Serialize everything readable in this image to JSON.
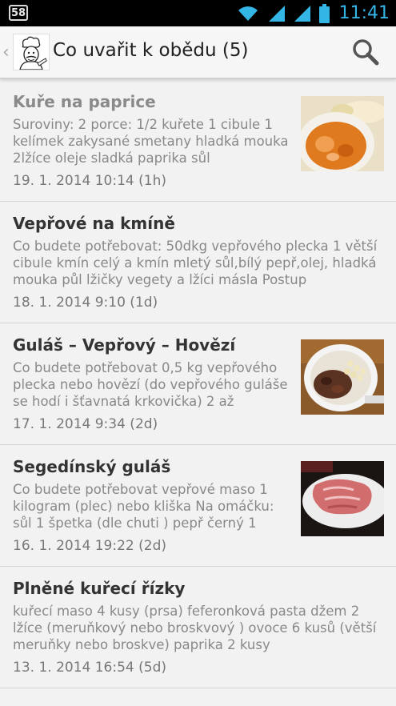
{
  "status_bar": {
    "badge": "58",
    "time": "11:41",
    "icons": [
      "wifi-icon",
      "signal-icon",
      "signal-icon",
      "battery-icon"
    ]
  },
  "action_bar": {
    "title": "Co uvařit k obědu (5)",
    "icons": [
      "back-caret-icon",
      "chef-app-icon",
      "search-icon"
    ]
  },
  "recipes": [
    {
      "title": "Kuře na paprice",
      "description": "Suroviny: 2 porce: 1/2 kuřete 1 cibule 1 kelímek zakysané smetany hladká mouka 2lžíce oleje sladká paprika sůl",
      "date": "19. 1. 2014 10:14 (1h)",
      "has_image": true,
      "read": true
    },
    {
      "title": "Vepřové na kmíně",
      "description": "Co budete potřebovat: 50dkg vepřového plecka 1 větší cibule kmín celý a kmín mletý sůl,bílý pepř,olej, hladká mouka půl lžičky vegety a lžíci másla Postup",
      "date": "18. 1. 2014 9:10 (1d)",
      "has_image": false,
      "read": false
    },
    {
      "title": "Guláš – Vepřový – Hovězí",
      "description": "Co budete potřebovat 0,5 kg vepřového plecka nebo hovězí (do vepřového guláše se hodí i šťavnatá krkovička) 2 až",
      "date": "17. 1. 2014 9:34 (2d)",
      "has_image": true,
      "read": false
    },
    {
      "title": "Segedínský guláš",
      "description": "Co budete potřebovat vepřové maso 1 kilogram (plec) nebo kliška Na omáčku: sůl 1 špetka (dle chuti ) pepř černý 1",
      "date": "16. 1. 2014 19:22 (2d)",
      "has_image": true,
      "read": false
    },
    {
      "title": "Plněné kuřecí řízky",
      "description": "kuřecí maso 4 kusy (prsa) feferonková pasta džem 2 lžíce (meruňkový nebo broskvový ) ovoce 6 kusů (větší meruňky nebo broskve) paprika 2 kusy",
      "date": "13. 1. 2014 16:54 (5d)",
      "has_image": false,
      "read": false
    }
  ],
  "colors": {
    "status_time": "#33b5e5",
    "background": "#f2f2f2",
    "title_read": "#8a8a8a",
    "title": "#333333"
  }
}
